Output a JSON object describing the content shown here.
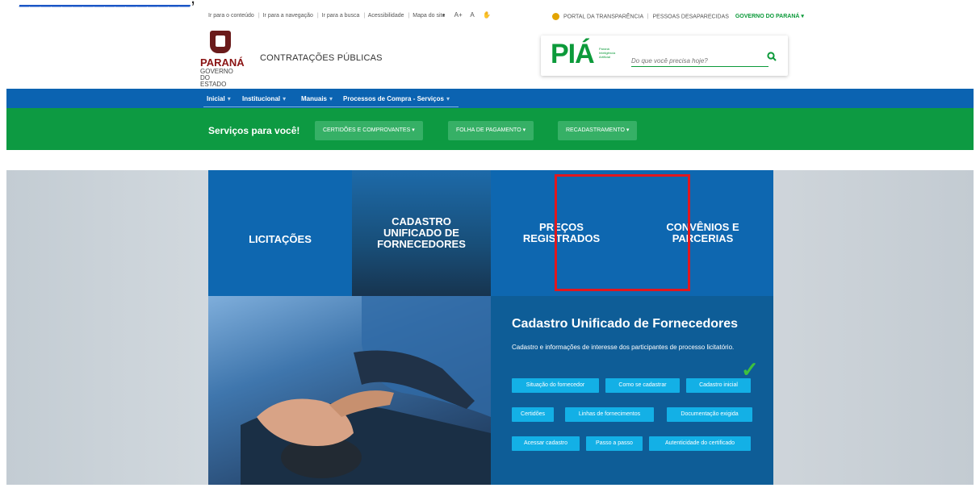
{
  "doc_fragment": {
    "link_text": "________________",
    "tail_text": ", "
  },
  "utility_bar": {
    "accessibility_links": [
      "Ir para o conteúdo",
      "Ir para a navegação",
      "Ir para a busca",
      "Acessibilidade",
      "Mapa do site"
    ],
    "tools": [
      "◐",
      "A+",
      "A",
      "✋"
    ],
    "right": {
      "transparency": "PORTAL DA TRANSPARÊNCIA",
      "missing": "PESSOAS DESAPARECIDAS",
      "gov": "GOVERNO DO PARANÁ ▾"
    }
  },
  "header": {
    "logo": {
      "state": "PARANÁ",
      "sub": "GOVERNO DO ESTADO"
    },
    "site_name": "CONTRATAÇÕES PÚBLICAS",
    "search": {
      "brand": "PIÁ",
      "brand_sub": "Paraná Inteligência Artificial",
      "placeholder": "Do que você precisa hoje?"
    }
  },
  "nav": {
    "items": [
      {
        "label": "Inicial"
      },
      {
        "label": "Institucional"
      },
      {
        "label": "Manuais"
      },
      {
        "label": "Processos de Compra - Serviços"
      }
    ]
  },
  "services": {
    "title": "Serviços para você!",
    "buttons": [
      "CERTIDÕES E COMPROVANTES ▾",
      "FOLHA DE PAGAMENTO ▾",
      "RECADASTRAMENTO ▾"
    ]
  },
  "tiles": [
    {
      "label": "LICITAÇÕES"
    },
    {
      "label": "CADASTRO UNIFICADO DE FORNECEDORES"
    },
    {
      "label": "PREÇOS REGISTRADOS"
    },
    {
      "label": "CONVÊNIOS E PARCERIAS"
    }
  ],
  "panel": {
    "title": "Cadastro Unificado de Fornecedores",
    "description": "Cadastro e informações de interesse dos participantes de processo licitatório.",
    "buttons": [
      "Situação do fornecedor",
      "Como se cadastrar",
      "Cadastro inicial",
      "Certidões",
      "Linhas de fornecimentos",
      "Documentação exigida",
      "Acessar cadastro",
      "Passo a passo",
      "Autenticidade do certificado"
    ],
    "check_mark": "✓"
  },
  "colors": {
    "nav_blue": "#0b63b1",
    "green": "#0d9a42",
    "tile_blue": "#0e67b0",
    "button_cyan": "#13b0e6",
    "highlight_red": "#e1171e"
  }
}
